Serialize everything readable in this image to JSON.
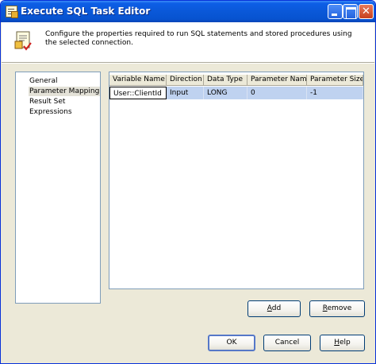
{
  "window": {
    "title": "Execute SQL Task Editor"
  },
  "header": {
    "description": "Configure the properties required to run SQL statements and stored procedures using the selected connection."
  },
  "nav": {
    "items": [
      {
        "label": "General"
      },
      {
        "label": "Parameter Mapping"
      },
      {
        "label": "Result Set"
      },
      {
        "label": "Expressions"
      }
    ]
  },
  "grid": {
    "columns": [
      "Variable Name",
      "Direction",
      "Data Type",
      "Parameter Name",
      "Parameter Size"
    ],
    "rows": [
      [
        "User::ClientId",
        "Input",
        "LONG",
        "0",
        "-1"
      ]
    ]
  },
  "buttons": {
    "add": {
      "mnemonic": "A",
      "rest": "dd"
    },
    "remove": {
      "mnemonic": "R",
      "rest": "emove"
    },
    "ok": "OK",
    "cancel": "Cancel",
    "help": {
      "mnemonic": "H",
      "rest": "elp"
    }
  },
  "icons": {
    "app": "execute-sql-task-icon",
    "header": "task-properties-icon"
  }
}
